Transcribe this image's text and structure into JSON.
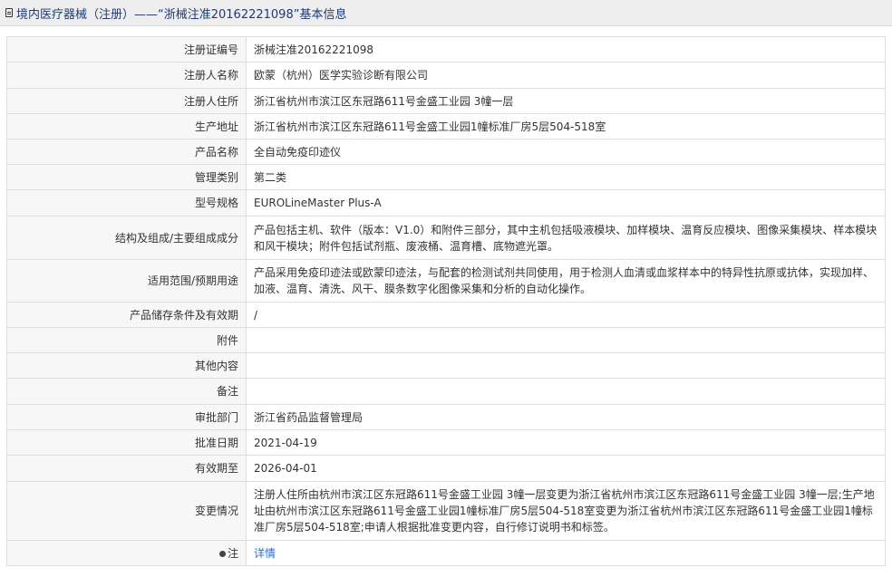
{
  "header": {
    "title": "境内医疗器械（注册）——“浙械注准20162221098”基本信息",
    "icon": "document-icon"
  },
  "rows": [
    {
      "label": "注册证编号",
      "value": "浙械注准20162221098"
    },
    {
      "label": "注册人名称",
      "value": "欧蒙（杭州）医学实验诊断有限公司"
    },
    {
      "label": "注册人住所",
      "value": "浙江省杭州市滨江区东冠路611号金盛工业园 3幢一层"
    },
    {
      "label": "生产地址",
      "value": "浙江省杭州市滨江区东冠路611号金盛工业园1幢标准厂房5层504-518室"
    },
    {
      "label": "产品名称",
      "value": "全自动免疫印迹仪"
    },
    {
      "label": "管理类别",
      "value": "第二类"
    },
    {
      "label": "型号规格",
      "value": "EUROLineMaster Plus-A"
    },
    {
      "label": "结构及组成/主要组成成分",
      "value": "产品包括主机、软件（版本：V1.0）和附件三部分，其中主机包括吸液模块、加样模块、温育反应模块、图像采集模块、样本模块和风干模块；附件包括试剂瓶、废液桶、温育槽、底物遮光罩。"
    },
    {
      "label": "适用范围/预期用途",
      "value": "产品采用免疫印迹法或欧蒙印迹法，与配套的检测试剂共同使用，用于检测人血清或血浆样本中的特异性抗原或抗体，实现加样、加液、温育、清洗、风干、膜条数字化图像采集和分析的自动化操作。"
    },
    {
      "label": "产品储存条件及有效期",
      "value": "/"
    },
    {
      "label": "附件",
      "value": ""
    },
    {
      "label": "其他内容",
      "value": ""
    },
    {
      "label": "备注",
      "value": ""
    },
    {
      "label": "审批部门",
      "value": "浙江省药品监督管理局"
    },
    {
      "label": "批准日期",
      "value": "2021-04-19"
    },
    {
      "label": "有效期至",
      "value": "2026-04-01"
    },
    {
      "label": "变更情况",
      "value": "注册人住所由杭州市滨江区东冠路611号金盛工业园 3幢一层变更为浙江省杭州市滨江区东冠路611号金盛工业园 3幢一层;生产地址由杭州市滨江区东冠路611号金盛工业园1幢标准厂房5层504-518室变更为浙江省杭州市滨江区东冠路611号金盛工业园1幢标准厂房5层504-518室;申请人根据批准变更内容，自行修订说明书和标签。"
    }
  ],
  "note": {
    "label": "注",
    "icon": "lightbulb-icon",
    "link_text": "详情"
  },
  "colors": {
    "title_text": "#1e3a78",
    "label_bg": "#f7f7f7",
    "border": "#dedede",
    "link": "#2a6bd5"
  }
}
